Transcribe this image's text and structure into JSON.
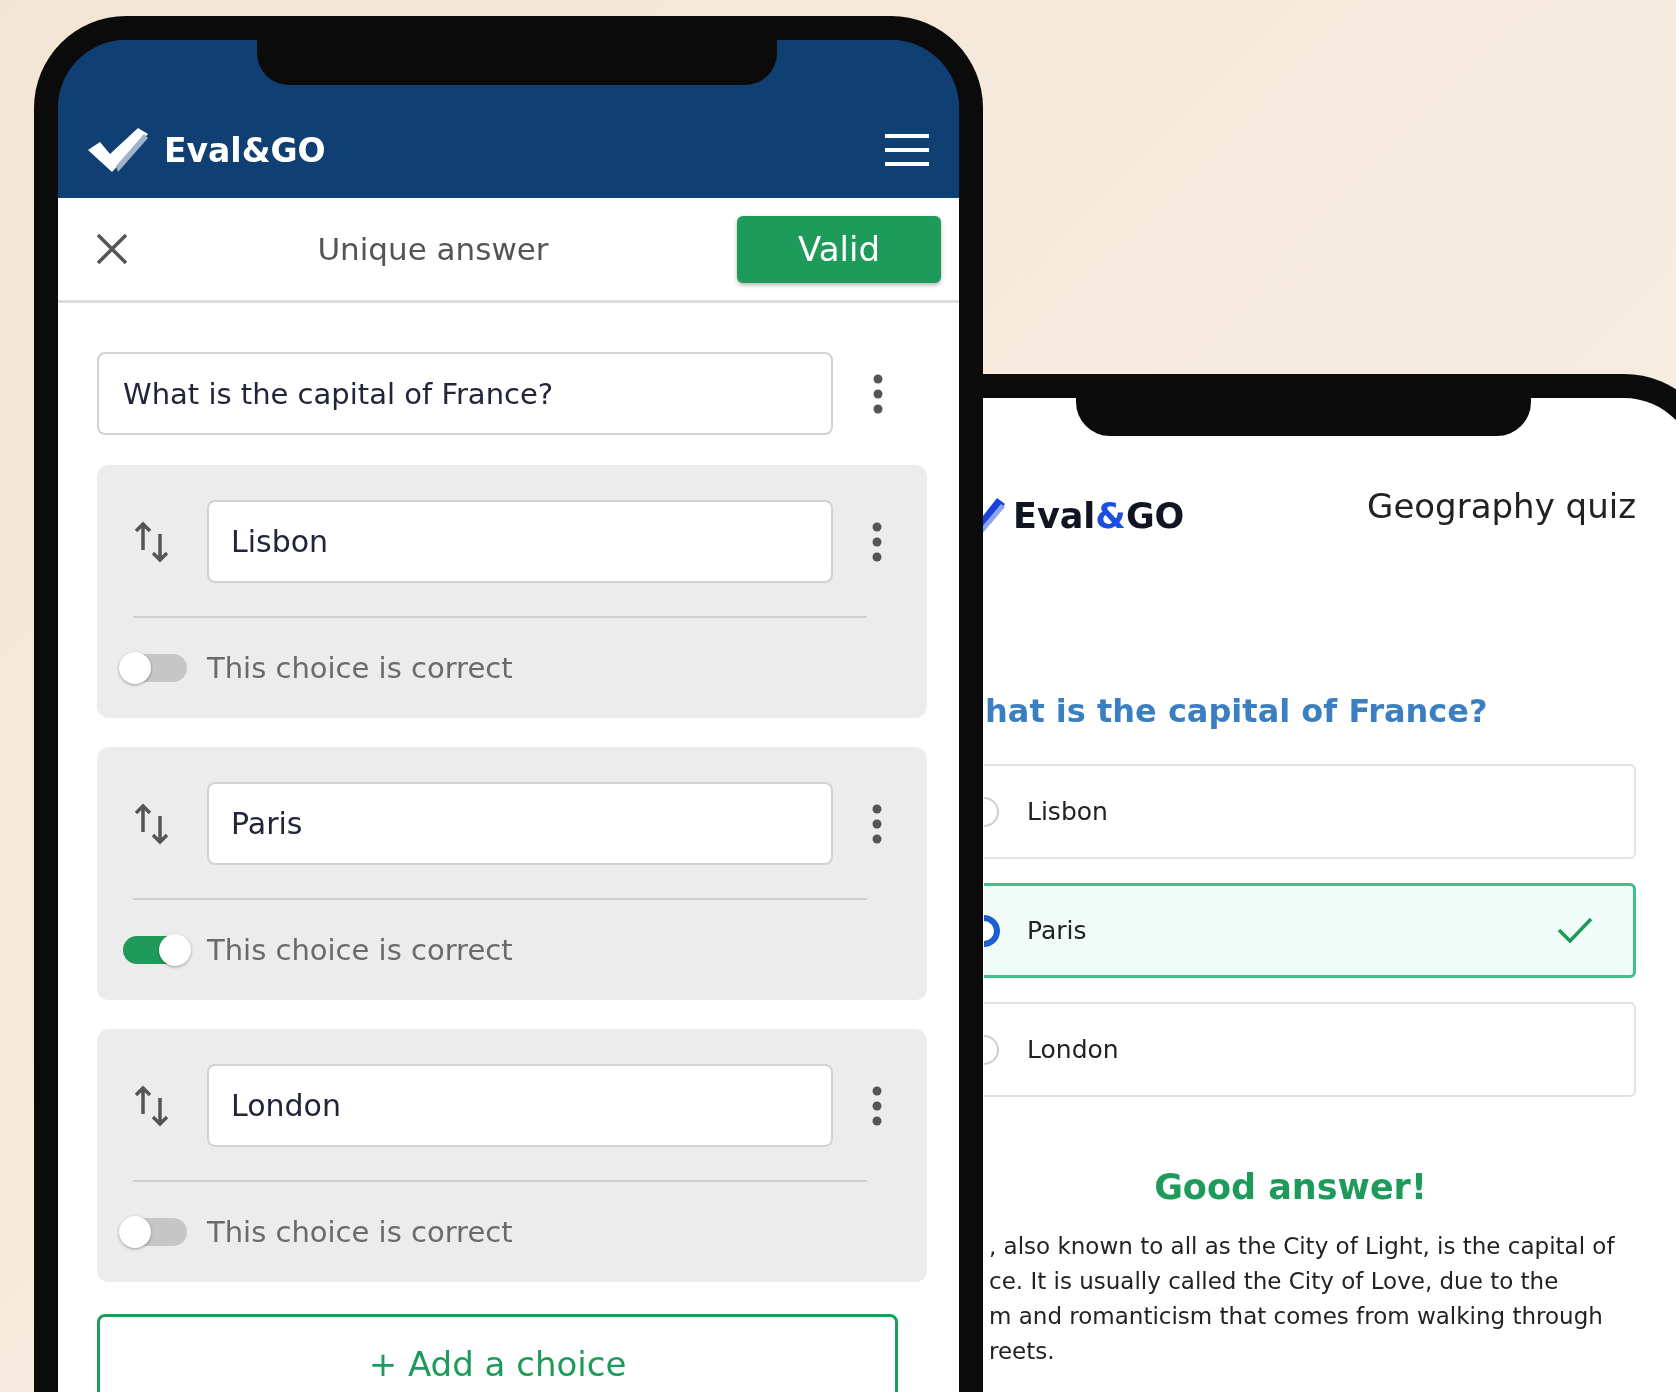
{
  "editor": {
    "brand": "Eval&GO",
    "toolbar": {
      "title": "Unique answer",
      "confirm_button": "Valid"
    },
    "question": "What is the capital of France?",
    "choices": [
      {
        "text": "Lisbon",
        "correct_label": "This choice is correct",
        "correct": false
      },
      {
        "text": "Paris",
        "correct_label": "This choice is correct",
        "correct": true
      },
      {
        "text": "London",
        "correct_label": "This choice is correct",
        "correct": false
      }
    ],
    "add_button": "+ Add a choice"
  },
  "quiz": {
    "brand_parts": [
      "Eval",
      "&",
      "GO"
    ],
    "title": "Geography quiz",
    "question": "hat is the capital of France?",
    "options": [
      {
        "label": "Lisbon",
        "selected": false
      },
      {
        "label": "Paris",
        "selected": true
      },
      {
        "label": "London",
        "selected": false
      }
    ],
    "feedback": "Good answer!",
    "explanation_lines": [
      ", also known to all as the City of Light, is the capital of",
      "ce. It is usually called the City of Love, due to the",
      "m and romanticism that comes from walking through",
      "reets."
    ]
  }
}
